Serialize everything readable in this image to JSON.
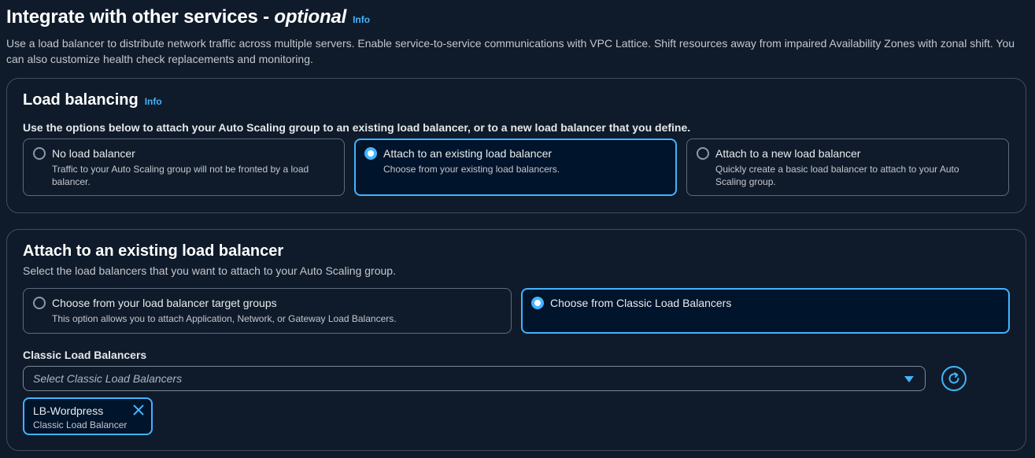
{
  "section": {
    "title_prefix": "Integrate with other services - ",
    "title_optional": "optional",
    "info_link": "Info",
    "description": "Use a load balancer to distribute network traffic across multiple servers. Enable service-to-service communications with VPC Lattice. Shift resources away from impaired Availability Zones with zonal shift. You can also customize health check replacements and monitoring."
  },
  "load_balancing": {
    "title": "Load balancing",
    "info_link": "Info",
    "instruction": "Use the options below to attach your Auto Scaling group to an existing load balancer, or to a new load balancer that you define.",
    "options": [
      {
        "label": "No load balancer",
        "description": "Traffic to your Auto Scaling group will not be fronted by a load balancer.",
        "selected": false
      },
      {
        "label": "Attach to an existing load balancer",
        "description": "Choose from your existing load balancers.",
        "selected": true
      },
      {
        "label": "Attach to a new load balancer",
        "description": "Quickly create a basic load balancer to attach to your Auto Scaling group.",
        "selected": false
      }
    ]
  },
  "existing_lb": {
    "title": "Attach to an existing load balancer",
    "description": "Select the load balancers that you want to attach to your Auto Scaling group.",
    "options": [
      {
        "label": "Choose from your load balancer target groups",
        "description": "This option allows you to attach Application, Network, or Gateway Load Balancers.",
        "selected": false
      },
      {
        "label": "Choose from Classic Load Balancers",
        "description": "",
        "selected": true
      }
    ],
    "field_label": "Classic Load Balancers",
    "select_placeholder": "Select Classic Load Balancers",
    "tokens": [
      {
        "name": "LB-Wordpress",
        "type": "Classic Load Balancer"
      }
    ]
  },
  "icons": {
    "caret": "caret-down-icon",
    "refresh": "refresh-icon",
    "remove": "close-icon"
  },
  "colors": {
    "accent": "#42b4ff",
    "background": "#0f1b2a",
    "selected_background": "#00142b",
    "border": "#414d5c"
  }
}
